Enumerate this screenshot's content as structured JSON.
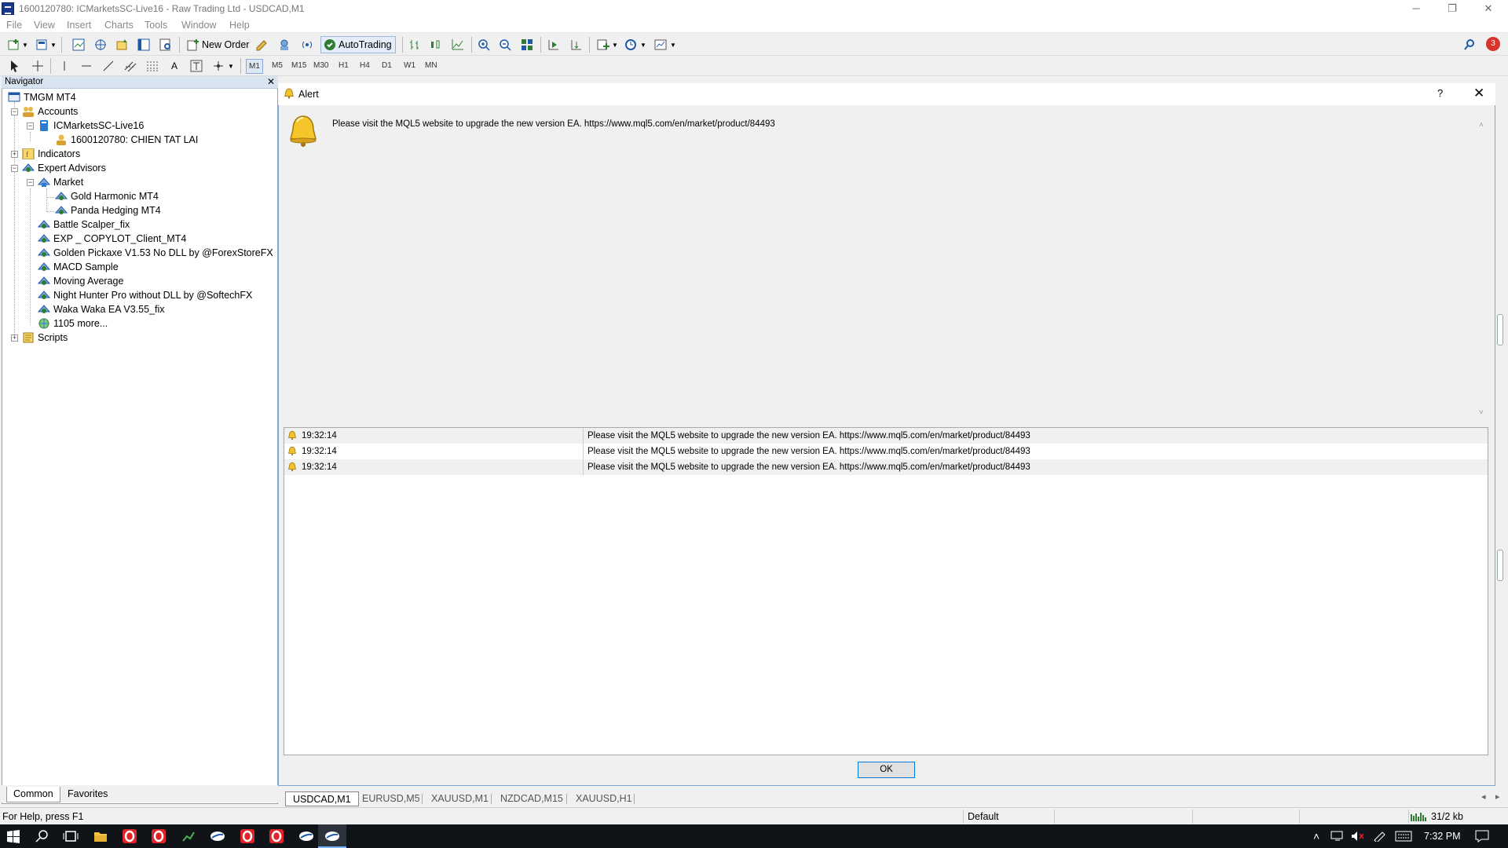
{
  "window": {
    "title": "1600120780: ICMarketsSC-Live16 - Raw Trading Ltd - USDCAD,M1"
  },
  "menu": [
    "File",
    "View",
    "Insert",
    "Charts",
    "Tools",
    "Window",
    "Help"
  ],
  "toolbar": {
    "new_order": "New Order",
    "auto_trading": "AutoTrading",
    "timeframes": [
      "M1",
      "M5",
      "M15",
      "M30",
      "H1",
      "H4",
      "D1",
      "W1",
      "MN"
    ],
    "active_timeframe": "M1",
    "notification_count": "3"
  },
  "navigator": {
    "header": "Navigator",
    "root": "TMGM MT4",
    "accounts": "Accounts",
    "server": "ICMarketsSC-Live16",
    "account": "1600120780: CHIEN TAT LAI",
    "indicators": "Indicators",
    "expert_advisors": "Expert Advisors",
    "market": "Market",
    "market_items": [
      "Gold Harmonic MT4",
      "Panda Hedging MT4"
    ],
    "ea_items": [
      "Battle Scalper_fix",
      "EXP _ COPYLOT_Client_MT4",
      "Golden Pickaxe V1.53 No DLL by @ForexStoreFX",
      "MACD Sample",
      "Moving Average",
      "Night Hunter Pro without DLL by @SoftechFX",
      "Waka Waka EA V3.55_fix"
    ],
    "more": "1105 more...",
    "scripts": "Scripts",
    "tabs": [
      "Common",
      "Favorites"
    ]
  },
  "alert": {
    "title": "Alert",
    "help": "?",
    "message": "Please visit the MQL5 website to upgrade the new version EA. https://www.mql5.com/en/market/product/84493",
    "rows": [
      {
        "time": "19:32:14",
        "message": "Please visit the MQL5 website to upgrade the new version EA. https://www.mql5.com/en/market/product/84493"
      },
      {
        "time": "19:32:14",
        "message": "Please visit the MQL5 website to upgrade the new version EA. https://www.mql5.com/en/market/product/84493"
      },
      {
        "time": "19:32:14",
        "message": "Please visit the MQL5 website to upgrade the new version EA. https://www.mql5.com/en/market/product/84493"
      }
    ],
    "ok": "OK"
  },
  "chart_tabs": [
    "USDCAD,M1",
    "EURUSD,M5",
    "XAUUSD,M1",
    "NZDCAD,M15",
    "XAUUSD,H1"
  ],
  "status": {
    "help": "For Help, press F1",
    "profile": "Default",
    "traffic": "31/2 kb"
  },
  "taskbar": {
    "time": "7:32 PM"
  }
}
